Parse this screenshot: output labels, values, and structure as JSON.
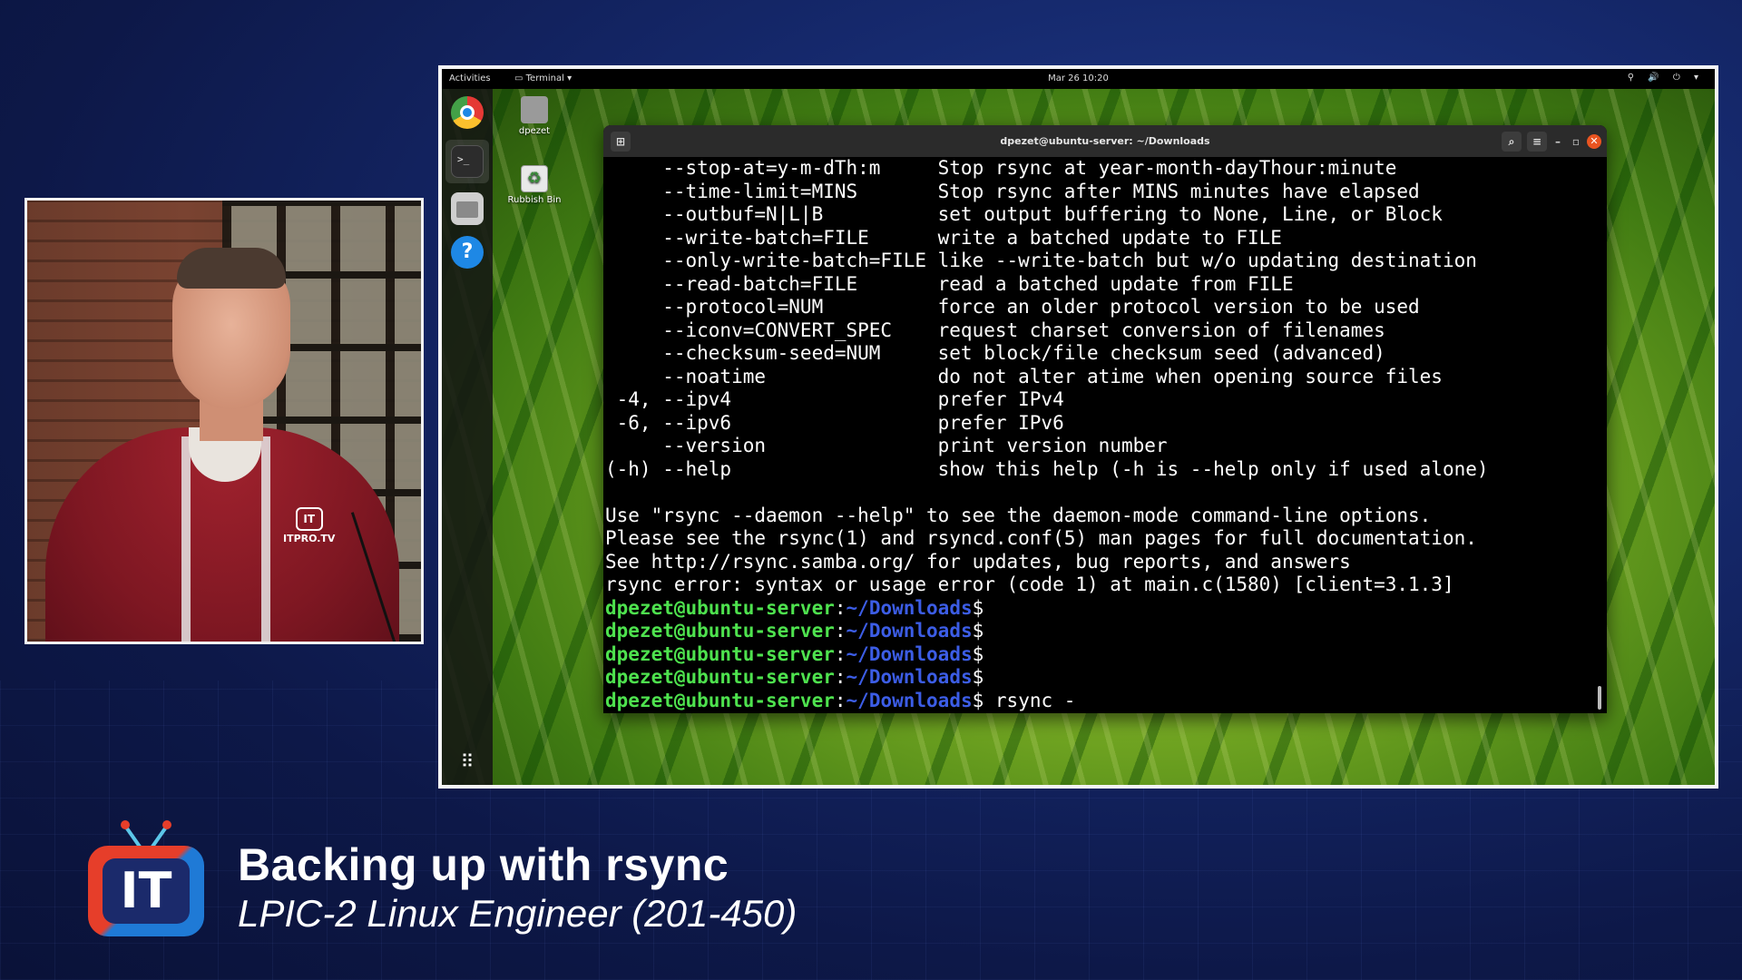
{
  "screen": {
    "topbar": {
      "activities": "Activities",
      "app_menu": "Terminal ▾",
      "clock": "Mar 26  10:20",
      "system_icons": "⚲ 🔊 ⏻ ▾"
    },
    "desktop_icons": [
      {
        "label": "dpezet"
      },
      {
        "label": "Rubbish Bin"
      }
    ],
    "terminal": {
      "title": "dpezet@ubuntu-server: ~/Downloads",
      "lines": [
        "     --stop-at=y-m-dTh:m     Stop rsync at year-month-dayThour:minute",
        "     --time-limit=MINS       Stop rsync after MINS minutes have elapsed",
        "     --outbuf=N|L|B          set output buffering to None, Line, or Block",
        "     --write-batch=FILE      write a batched update to FILE",
        "     --only-write-batch=FILE like --write-batch but w/o updating destination",
        "     --read-batch=FILE       read a batched update from FILE",
        "     --protocol=NUM          force an older protocol version to be used",
        "     --iconv=CONVERT_SPEC    request charset conversion of filenames",
        "     --checksum-seed=NUM     set block/file checksum seed (advanced)",
        "     --noatime               do not alter atime when opening source files",
        " -4, --ipv4                  prefer IPv4",
        " -6, --ipv6                  prefer IPv6",
        "     --version               print version number",
        "(-h) --help                  show this help (-h is --help only if used alone)",
        "",
        "Use \"rsync --daemon --help\" to see the daemon-mode command-line options.",
        "Please see the rsync(1) and rsyncd.conf(5) man pages for full documentation.",
        "See http://rsync.samba.org/ for updates, bug reports, and answers",
        "rsync error: syntax or usage error (code 1) at main.c(1580) [client=3.1.3]"
      ],
      "prompt_user": "dpezet@ubuntu-server",
      "prompt_sep": ":",
      "prompt_path": "~/Downloads",
      "prompt_symbol": "$",
      "prompts": [
        "",
        "",
        "",
        "",
        " rsync -"
      ]
    }
  },
  "presenter": {
    "shirt_logo": "ITPRO.TV"
  },
  "lower_third": {
    "logo_text": "IT",
    "title": "Backing up with rsync",
    "subtitle": "LPIC-2 Linux Engineer (201-450)"
  },
  "colors": {
    "prompt_user": "#4ee24e",
    "prompt_path": "#3c5de6",
    "ubuntu_close": "#e95420"
  }
}
